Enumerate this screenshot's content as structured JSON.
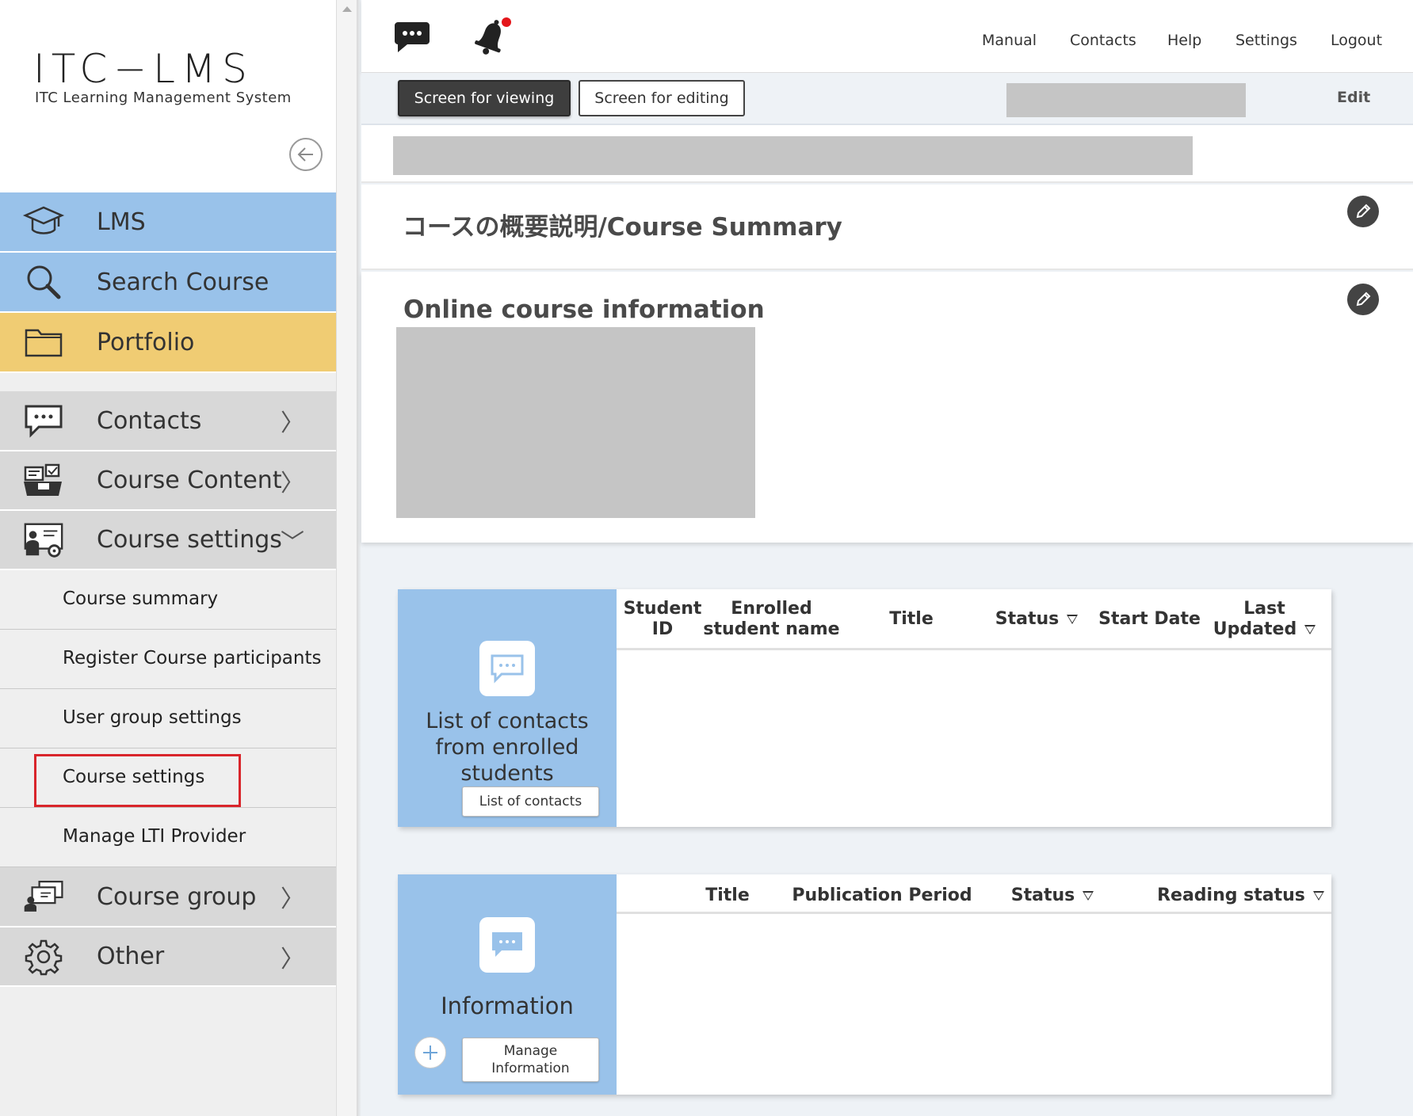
{
  "logo": {
    "main": "ITC−LMS",
    "sub": "ITC Learning Management System"
  },
  "sidebar": {
    "primary": [
      {
        "label": "LMS",
        "icon": "graduation-cap-icon"
      },
      {
        "label": "Search Course",
        "icon": "magnifier-icon"
      },
      {
        "label": "Portfolio",
        "icon": "folder-icon"
      }
    ],
    "sections": [
      {
        "label": "Contacts",
        "icon": "speech-bubble-icon",
        "chevron": "〉"
      },
      {
        "label": "Course Content",
        "icon": "course-content-icon",
        "chevron": "〉"
      },
      {
        "label": "Course settings",
        "icon": "course-settings-icon",
        "chevron": "﹀"
      },
      {
        "label": "Course group",
        "icon": "course-group-icon",
        "chevron": "〉"
      },
      {
        "label": "Other",
        "icon": "gear-icon",
        "chevron": "〉"
      }
    ],
    "course_settings_items": [
      "Course summary",
      "Register Course participants",
      "User group settings",
      "Course settings",
      "Manage LTI Provider"
    ]
  },
  "topbar": {
    "links": [
      "Manual",
      "Contacts",
      "Help",
      "Settings",
      "Logout"
    ],
    "notification_color": "#e4161b"
  },
  "modebar": {
    "viewing_label": "Screen for viewing",
    "editing_label": "Screen for editing",
    "edit_label": "Edit"
  },
  "course_summary": {
    "title": "コースの概要説明/Course Summary"
  },
  "online_info": {
    "title": "Online course information"
  },
  "contacts_card": {
    "title_lines": [
      "List of contacts",
      "from enrolled",
      "students"
    ],
    "button": "List of contacts",
    "headers": {
      "student_id": [
        "Student",
        "ID"
      ],
      "name": [
        "Enrolled",
        "student name"
      ],
      "title": "Title",
      "status": "Status",
      "start_date": "Start Date",
      "last_updated": [
        "Last",
        "Updated"
      ]
    }
  },
  "info_card": {
    "title": "Information",
    "button_lines": [
      "Manage",
      "Information"
    ],
    "headers": {
      "title": "Title",
      "period": "Publication Period",
      "status": "Status",
      "reading": "Reading status"
    }
  },
  "colors": {
    "nav_blue": "#99c2ea",
    "nav_yellow": "#f0cc73",
    "highlight": "#d9252b"
  }
}
